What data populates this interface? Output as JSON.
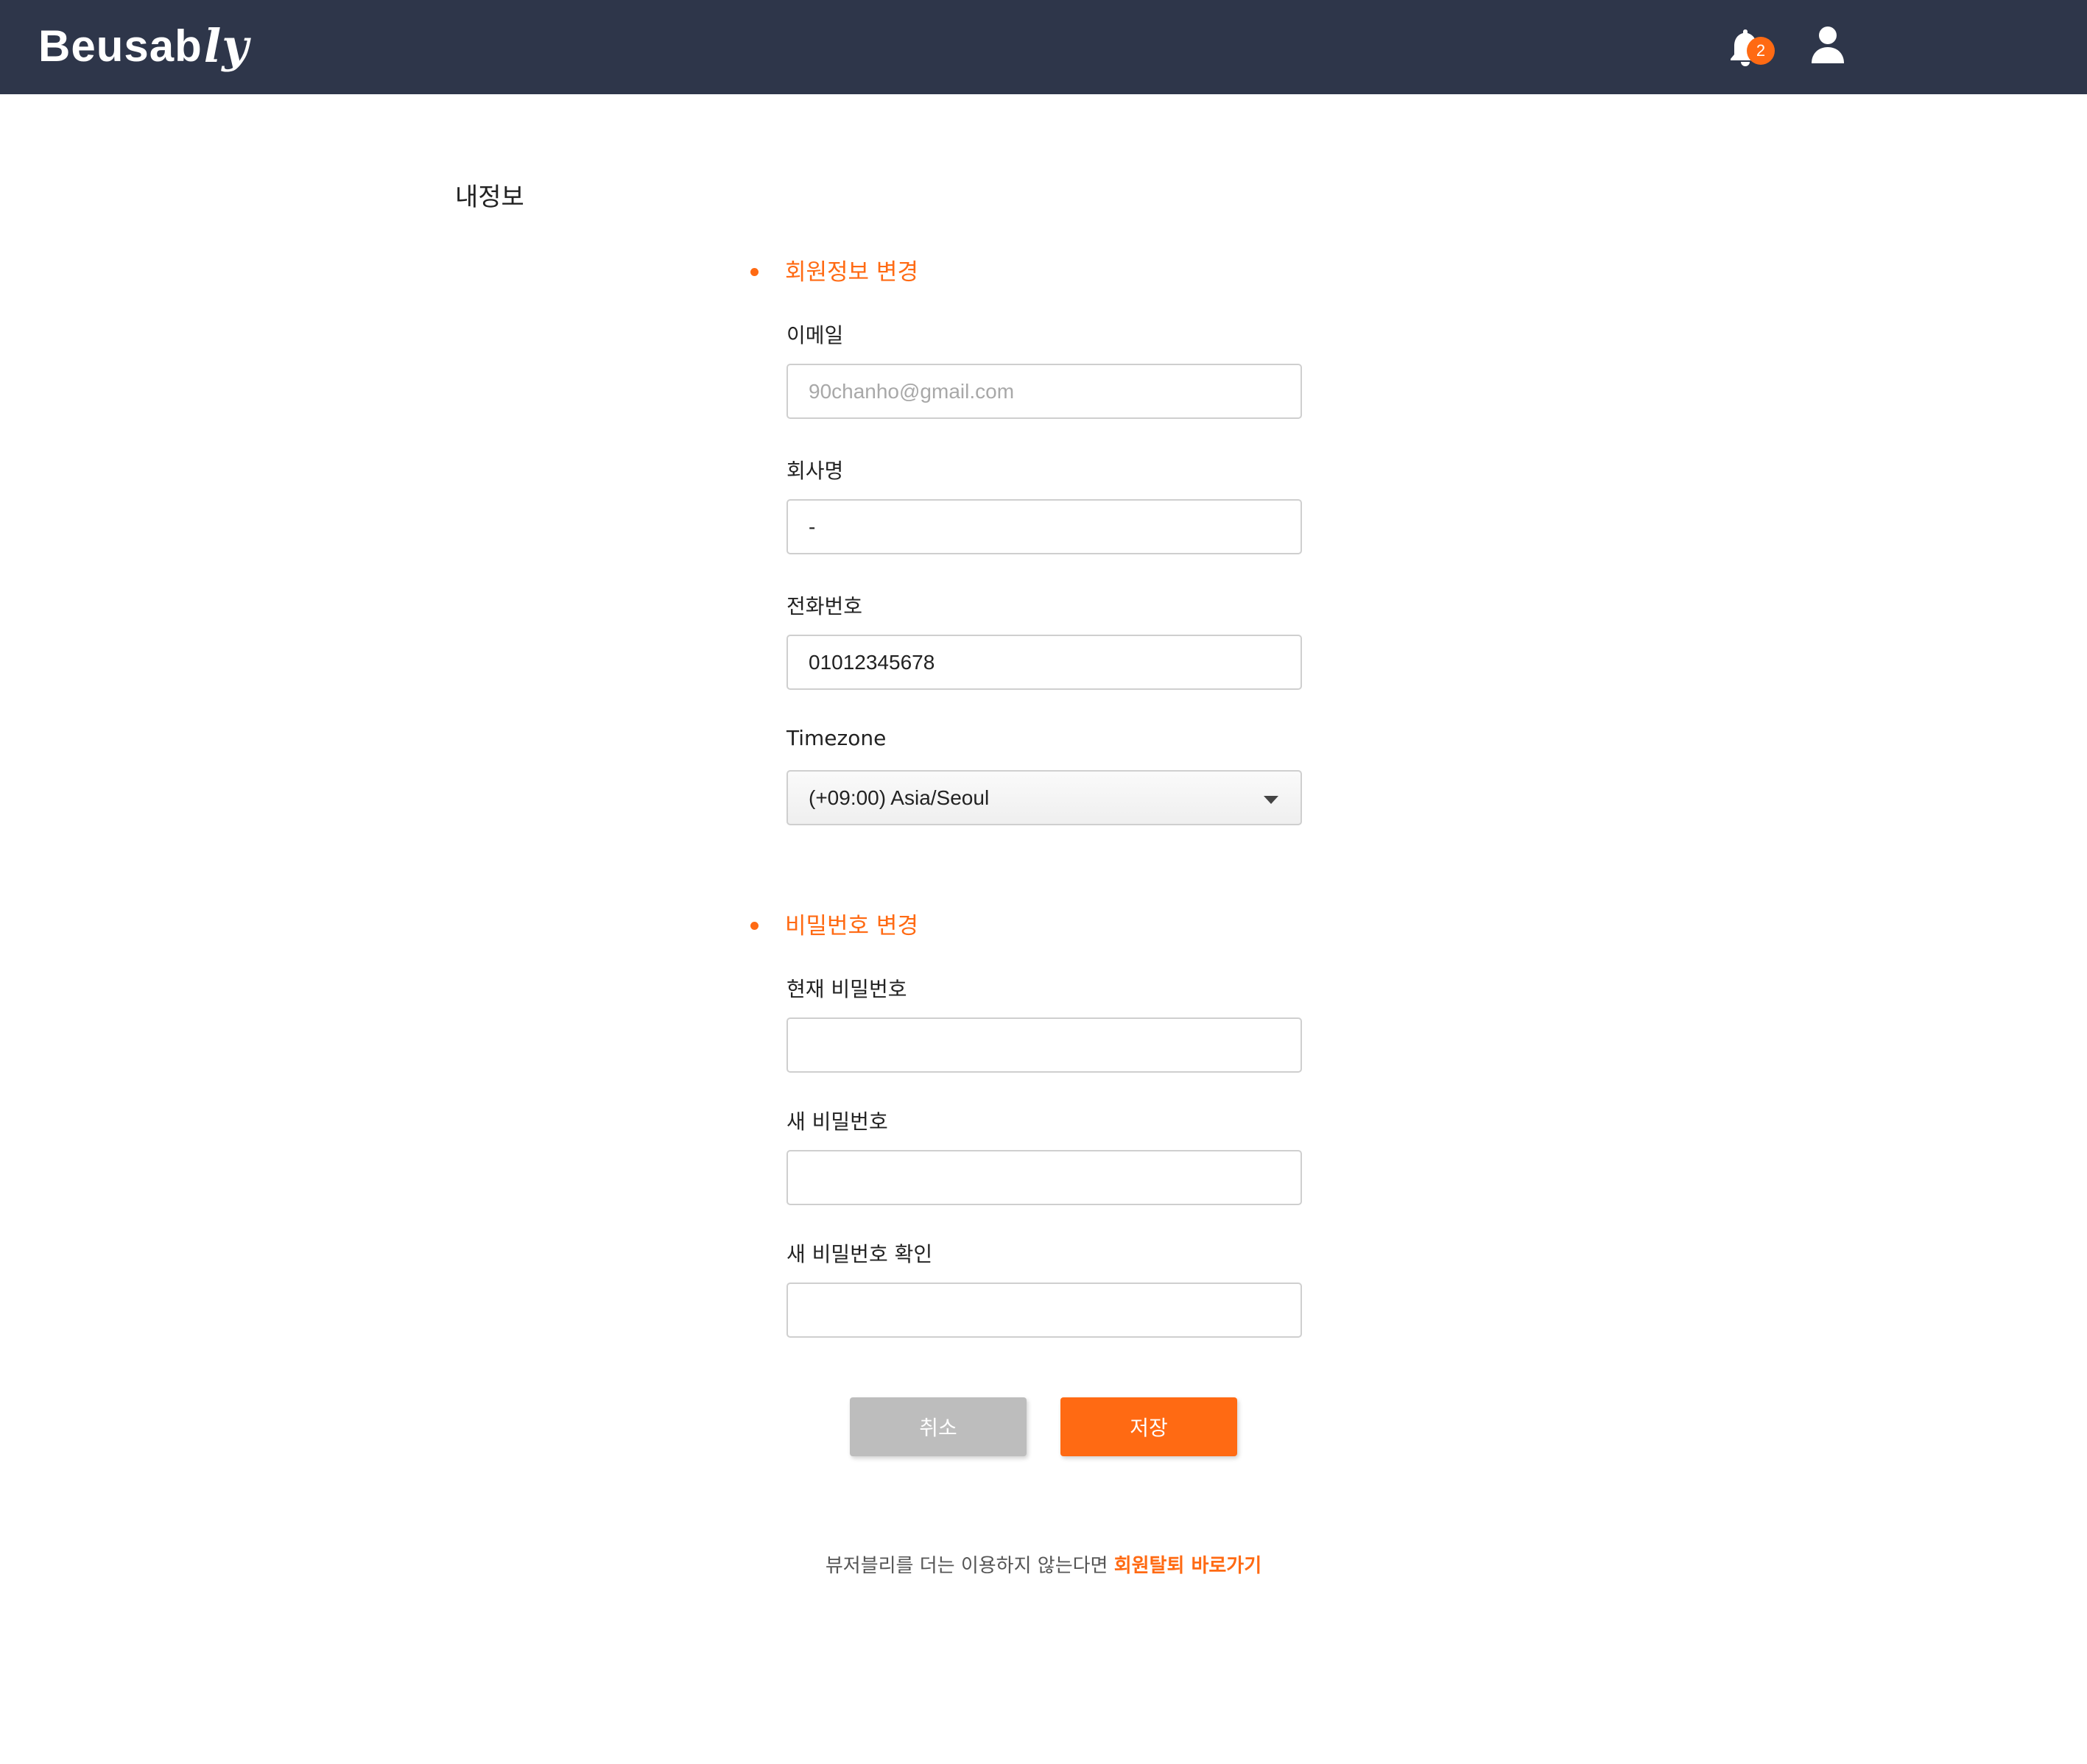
{
  "header": {
    "logo_text": "Beusab",
    "logo_suffix": "ly",
    "notification_count": "2",
    "icons": [
      "bell-icon",
      "user-icon"
    ]
  },
  "page": {
    "title": "내정보"
  },
  "profile_section": {
    "title": "회원정보 변경",
    "email_label": "이메일",
    "email_value": "90chanho@gmail.com",
    "company_label": "회사명",
    "company_value": "-",
    "phone_label": "전화번호",
    "phone_value": "01012345678",
    "timezone_label": "Timezone",
    "timezone_value": "(+09:00) Asia/Seoul"
  },
  "password_section": {
    "title": "비밀번호 변경",
    "current_label": "현재 비밀번호",
    "current_value": "",
    "new_label": "새 비밀번호",
    "new_value": "",
    "confirm_label": "새 비밀번호 확인",
    "confirm_value": ""
  },
  "actions": {
    "cancel_label": "취소",
    "save_label": "저장"
  },
  "footer": {
    "note": "뷰저블리를 더는 이용하지 않는다면 ",
    "link": "회원탈퇴 바로가기"
  },
  "colors": {
    "header_bg": "#2e364a",
    "accent": "#ff6a13",
    "cancel_bg": "#bdbdbd"
  }
}
